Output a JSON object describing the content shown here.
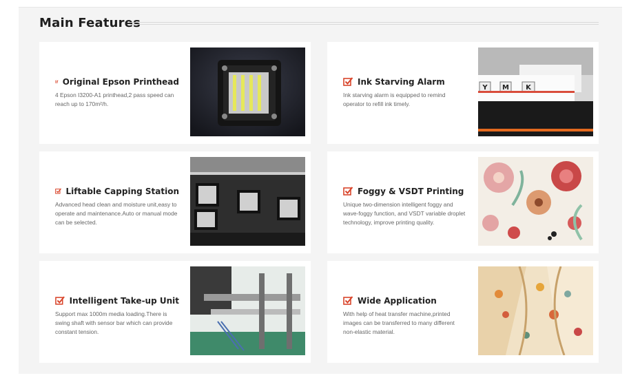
{
  "section": {
    "title": "Main Features"
  },
  "features": [
    {
      "title": "Original Epson Printhead",
      "description": "4 Epson I3200-A1 printhead,2 pass speed can reach up to 170m²/h."
    },
    {
      "title": "Ink Starving Alarm",
      "description": "Ink starving alarm is equipped to remind operator to refill ink timely.",
      "tank_labels": [
        "Y",
        "M",
        "K"
      ]
    },
    {
      "title": "Liftable Capping Station",
      "description": "Advanced head clean and moisture unit,easy to operate and maintenance.Auto or manual mode can be selected."
    },
    {
      "title": "Foggy & VSDT Printing",
      "description": "Unique two-dimension intelligent foggy and wave-foggy function, and VSDT variable droplet technology, improve printing quality."
    },
    {
      "title": "Intelligent Take-up Unit",
      "description": "Support max 1000m media loading.There is swing shaft with sensor bar which can provide constant tension."
    },
    {
      "title": "Wide Application",
      "description": "With help of heat transfer machine,printed images can be transferred to many different non-elastic material."
    }
  ],
  "colors": {
    "accent": "#d9452b",
    "panel": "#f4f4f4",
    "card": "#ffffff"
  }
}
